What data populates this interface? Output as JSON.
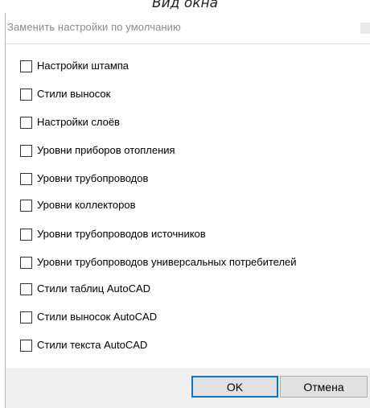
{
  "caption": "Вид окна",
  "window": {
    "title": "Заменить настройки по умолчанию"
  },
  "options": [
    {
      "label": "Настройки штампа",
      "checked": false
    },
    {
      "label": "Стили выносок",
      "checked": false
    },
    {
      "label": "Настройки слоёв",
      "checked": false
    },
    {
      "label": "Уровни приборов отопления",
      "checked": false
    },
    {
      "label": "Уровни трубопроводов",
      "checked": false
    },
    {
      "label": "Уровни коллекторов",
      "checked": false
    },
    {
      "label": "Уровни трубопроводов источников",
      "checked": false
    },
    {
      "label": "Уровни трубопроводов универсальных потребителей",
      "checked": false
    },
    {
      "label": "Стили таблиц AutoCAD",
      "checked": false
    },
    {
      "label": "Стили выносок AutoCAD",
      "checked": false
    },
    {
      "label": "Стили текста AutoCAD",
      "checked": false
    }
  ],
  "buttons": {
    "ok_label": "OK",
    "cancel_label": "Отмена"
  },
  "colors": {
    "accent": "#0078d7",
    "footer_bg": "#f0f0f0",
    "button_bg": "#e1e1e1"
  }
}
